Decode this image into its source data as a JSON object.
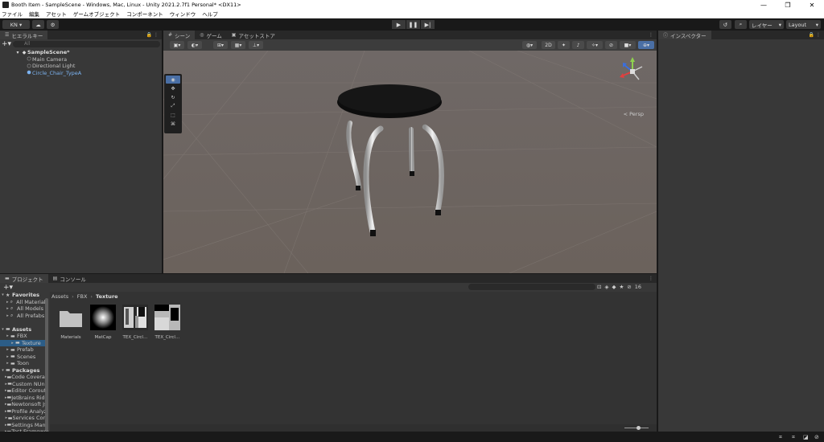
{
  "window": {
    "title": "Booth Item - SampleScene - Windows, Mac, Linux - Unity 2021.2.7f1 Personal* <DX11>",
    "minimize": "—",
    "maximize": "❐",
    "close": "✕"
  },
  "menu": [
    "ファイル",
    "編集",
    "アセット",
    "ゲームオブジェクト",
    "コンポーネント",
    "ウィンドウ",
    "ヘルプ"
  ],
  "toolbar": {
    "account": "KN ▾",
    "layers": "レイヤー",
    "layout": "Layout"
  },
  "hierarchy": {
    "tab": "ヒエラルキー",
    "search_placeholder": "All",
    "scene": "SampleScene*",
    "items": [
      "Main Camera",
      "Directional Light",
      "Circle_Chair_TypeA"
    ]
  },
  "scene": {
    "tabs": [
      "シーン",
      "ゲーム",
      "アセットストア"
    ],
    "mode_2d": "2D",
    "persp": "< Persp"
  },
  "inspector": {
    "tab": "インスペクター"
  },
  "project": {
    "tabs": [
      "プロジェクト",
      "コンソール"
    ],
    "asset_count": "16",
    "tree": [
      {
        "label": "Favorites",
        "level": 0,
        "bold": true
      },
      {
        "label": "All Materials",
        "level": 1
      },
      {
        "label": "All Models",
        "level": 1
      },
      {
        "label": "All Prefabs",
        "level": 1
      },
      {
        "label": "",
        "level": 0
      },
      {
        "label": "Assets",
        "level": 0,
        "bold": true
      },
      {
        "label": "FBX",
        "level": 1
      },
      {
        "label": "Texture",
        "level": 2,
        "selected": true
      },
      {
        "label": "Prefab",
        "level": 1
      },
      {
        "label": "Scenes",
        "level": 1
      },
      {
        "label": "Toon",
        "level": 1
      },
      {
        "label": "Packages",
        "level": 0,
        "bold": true
      },
      {
        "label": "Code Coverage",
        "level": 1
      },
      {
        "label": "Custom NUnit",
        "level": 1
      },
      {
        "label": "Editor Coroutines",
        "level": 1
      },
      {
        "label": "JetBrains Rider Editor",
        "level": 1
      },
      {
        "label": "Newtonsoft Json",
        "level": 1
      },
      {
        "label": "Profile Analyzer",
        "level": 1
      },
      {
        "label": "Services Core",
        "level": 1
      },
      {
        "label": "Settings Manager",
        "level": 1
      },
      {
        "label": "Test Framework",
        "level": 1
      }
    ],
    "breadcrumb": [
      "Assets",
      "FBX",
      "Texture"
    ],
    "assets": [
      {
        "label": "Materials",
        "kind": "folder"
      },
      {
        "label": "MatCap",
        "kind": "matcap"
      },
      {
        "label": "TEX_Circl…",
        "kind": "tex1"
      },
      {
        "label": "TEX_Circl…",
        "kind": "tex2"
      }
    ]
  },
  "colors": {
    "accent_selected": "#2c5d87",
    "hierarchy_selected_text": "#7cb3f1",
    "tool_active": "#4a6fa5"
  }
}
